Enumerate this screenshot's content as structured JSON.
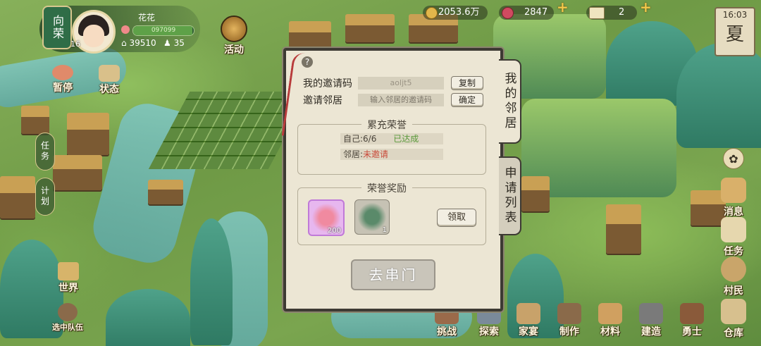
{
  "player": {
    "name_tag": "向荣",
    "level": "16",
    "name": "花花",
    "exp_text": "097099",
    "stat_a": "39510",
    "stat_b": "35",
    "exp_fraction": 0.98
  },
  "activity": {
    "label": "活动",
    "icon": "lantern-icon"
  },
  "resources": {
    "coins": "2053.6万",
    "flowers": "2847",
    "tickets": "2",
    "plus": "+"
  },
  "season": {
    "time": "16:03",
    "name": "夏"
  },
  "left_menu": {
    "pause": "暂停",
    "status": "状态",
    "task": "任务",
    "plan": "计划",
    "world": "世界",
    "team": "选中队伍"
  },
  "right_menu": {
    "news": "消息",
    "task": "任务",
    "villager": "村民",
    "warehouse": "仓库"
  },
  "bottom_menu": [
    {
      "label": "挑战",
      "icon": "sword-icon"
    },
    {
      "label": "探索",
      "icon": "map-icon"
    },
    {
      "label": "家宴",
      "icon": "bowl-icon"
    },
    {
      "label": "制作",
      "icon": "anvil-icon"
    },
    {
      "label": "材料",
      "icon": "wood-icon"
    },
    {
      "label": "建造",
      "icon": "hammer-icon"
    },
    {
      "label": "勇士",
      "icon": "warrior-icon"
    }
  ],
  "dialog": {
    "help": "?",
    "my_code_label": "我的邀请码",
    "my_code": "aoljt5",
    "copy_btn": "复制",
    "invite_label": "邀请邻居",
    "invite_placeholder": "输入邻居的邀请码",
    "confirm_btn": "确定",
    "honor_title": "累充荣誉",
    "self_row": "自己:6/6",
    "self_status": "已达成",
    "neighbor_row": "邻居:",
    "neighbor_status": "未邀请",
    "reward_title": "荣誉奖励",
    "reward_items": [
      {
        "icon": "flower-token-icon",
        "count": "200"
      },
      {
        "icon": "jade-stone-icon",
        "count": "1"
      }
    ],
    "claim_btn": "领取",
    "go_btn": "去串门",
    "tab_neighbors": "我的邻居",
    "tab_requests": "申请列表"
  },
  "colors": {
    "dialog_bg": "#ece6d4",
    "success": "#5a9a3a",
    "warn": "#c94a3a",
    "reward_highlight": "#d9a8e8"
  }
}
